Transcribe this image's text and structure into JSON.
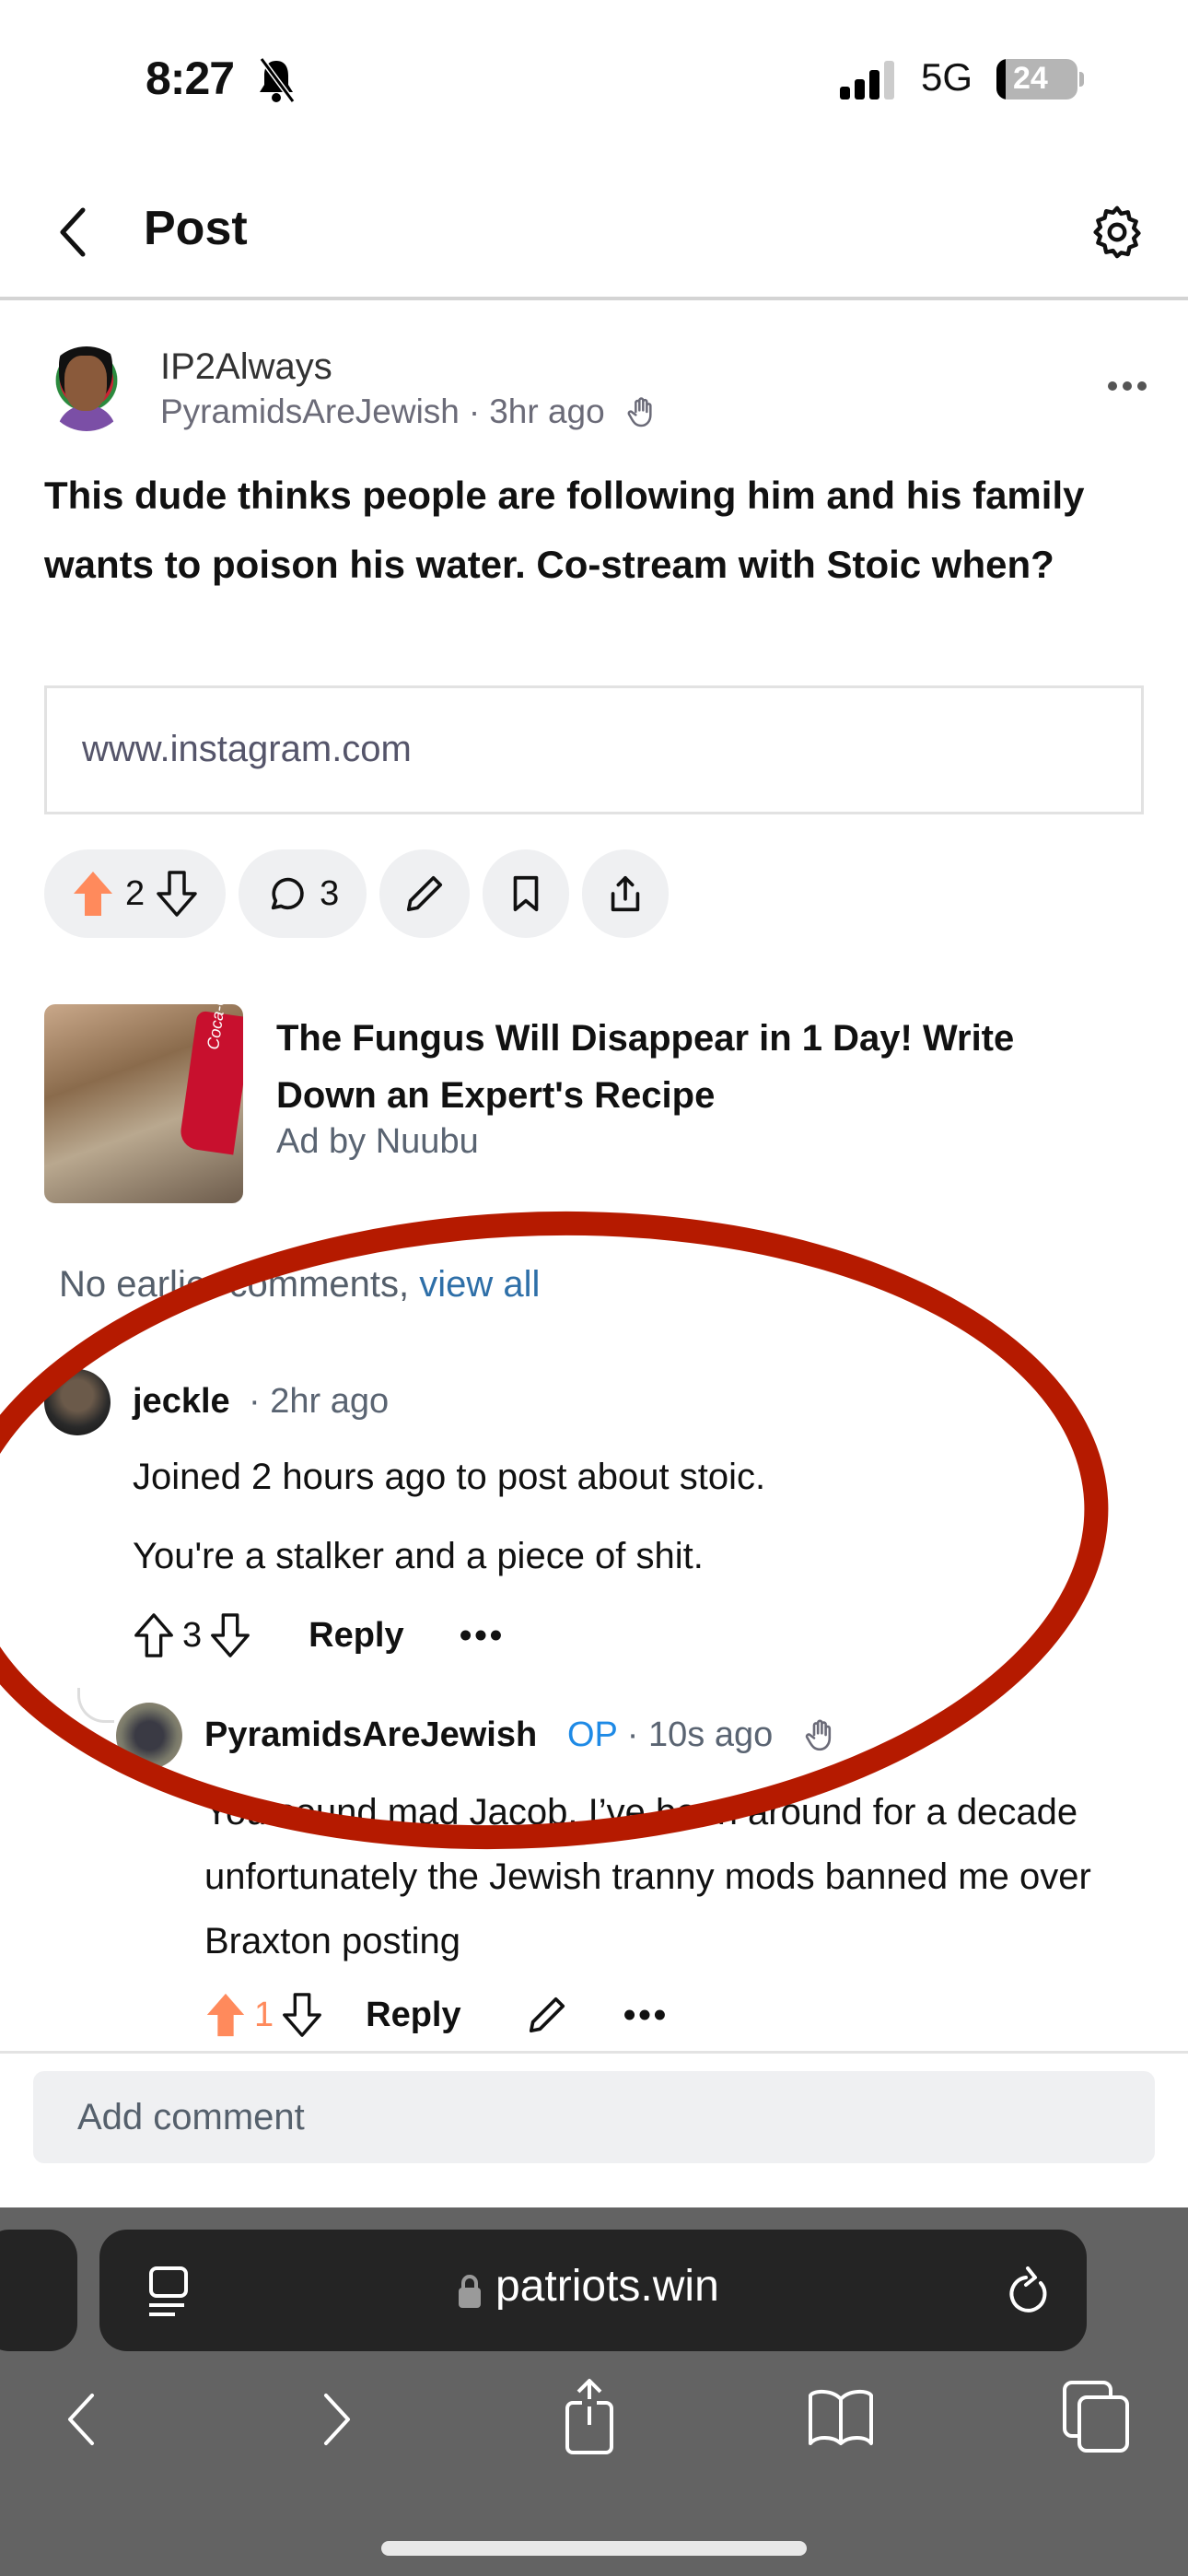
{
  "status_bar": {
    "time": "8:27",
    "silent_icon": "bell-slash-icon",
    "signal_icon": "cellular-signal-icon",
    "network": "5G",
    "battery_level": "24"
  },
  "header": {
    "back_icon": "chevron-left-icon",
    "title": "Post",
    "settings_icon": "gear-icon"
  },
  "post": {
    "author": "IP2Always",
    "community": "PyramidsAreJewish",
    "separator": "·",
    "time": "3hr ago",
    "hand_icon": "hand-raised-icon",
    "body": "This dude thinks people are following him and his family wants to poison his water. Co-stream with Stoic when?",
    "link": "www.instagram.com",
    "upvotes": "2",
    "comments": "3",
    "upvote_color": "#ff8a5c"
  },
  "ad": {
    "title": "The Fungus Will Disappear in 1 Day! Write Down an Expert's Recipe",
    "by": "Ad by Nuubu",
    "thumb_label": "Coca-Cola"
  },
  "comments_section": {
    "earlier_text": "No earlier comments, ",
    "view_all": "view all",
    "view_all_color": "#2e6fa8"
  },
  "comments": [
    {
      "author": "jeckle",
      "meta": "· 2hr ago",
      "paragraphs": [
        "Joined 2 hours ago to post about stoic.",
        "You're a stalker and a piece of shit."
      ],
      "votes": "3",
      "reply_label": "Reply"
    },
    {
      "author": "PyramidsAreJewish",
      "badge": "OP",
      "meta": "· 10s ago",
      "text": "You sound mad Jacob. I’ve been around for a decade unfortunately the Jewish tranny mods banned me over Braxton posting",
      "votes": "1",
      "reply_label": "Reply"
    }
  ],
  "composer": {
    "placeholder": "Add comment"
  },
  "browser": {
    "url": "patriots.win",
    "annotation_color": "#b51a00"
  }
}
